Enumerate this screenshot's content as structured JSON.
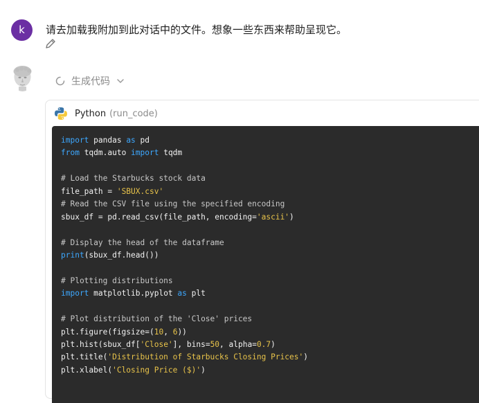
{
  "user": {
    "avatar_letter": "k",
    "avatar_color": "#6b2fa3",
    "message": "请去加载我附加到此对话中的文件。想象一些东西来帮助呈现它。"
  },
  "assistant": {
    "status_label": "生成代码"
  },
  "tool": {
    "language": "Python",
    "function": "(run_code)"
  },
  "code_lines": [
    [
      {
        "t": "import",
        "c": "kw"
      },
      {
        "t": " pandas ",
        "c": "op"
      },
      {
        "t": "as",
        "c": "kw"
      },
      {
        "t": " pd",
        "c": "op"
      }
    ],
    [
      {
        "t": "from",
        "c": "kw"
      },
      {
        "t": " tqdm.auto ",
        "c": "op"
      },
      {
        "t": "import",
        "c": "kw"
      },
      {
        "t": " tqdm",
        "c": "op"
      }
    ],
    [],
    [
      {
        "t": "# Load the Starbucks stock data",
        "c": "cm"
      }
    ],
    [
      {
        "t": "file_path = ",
        "c": "op"
      },
      {
        "t": "'SBUX.csv'",
        "c": "st"
      }
    ],
    [
      {
        "t": "# Read the CSV file using the specified encoding",
        "c": "cm"
      }
    ],
    [
      {
        "t": "sbux_df = pd.read_csv(file_path, encoding=",
        "c": "op"
      },
      {
        "t": "'ascii'",
        "c": "st"
      },
      {
        "t": ")",
        "c": "op"
      }
    ],
    [],
    [
      {
        "t": "# Display the head of the dataframe",
        "c": "cm"
      }
    ],
    [
      {
        "t": "print",
        "c": "kw"
      },
      {
        "t": "(sbux_df.head())",
        "c": "op"
      }
    ],
    [],
    [
      {
        "t": "# Plotting distributions",
        "c": "cm"
      }
    ],
    [
      {
        "t": "import",
        "c": "kw"
      },
      {
        "t": " matplotlib.pyplot ",
        "c": "op"
      },
      {
        "t": "as",
        "c": "kw"
      },
      {
        "t": " plt",
        "c": "op"
      }
    ],
    [],
    [
      {
        "t": "# Plot distribution of the 'Close' prices",
        "c": "cm"
      }
    ],
    [
      {
        "t": "plt.figure(figsize=(",
        "c": "op"
      },
      {
        "t": "10",
        "c": "nm"
      },
      {
        "t": ", ",
        "c": "op"
      },
      {
        "t": "6",
        "c": "nm"
      },
      {
        "t": "))",
        "c": "op"
      }
    ],
    [
      {
        "t": "plt.hist(sbux_df[",
        "c": "op"
      },
      {
        "t": "'Close'",
        "c": "st"
      },
      {
        "t": "], bins=",
        "c": "op"
      },
      {
        "t": "50",
        "c": "nm"
      },
      {
        "t": ", alpha=",
        "c": "op"
      },
      {
        "t": "0.7",
        "c": "nm"
      },
      {
        "t": ")",
        "c": "op"
      }
    ],
    [
      {
        "t": "plt.title(",
        "c": "op"
      },
      {
        "t": "'Distribution of Starbucks Closing Prices'",
        "c": "st"
      },
      {
        "t": ")",
        "c": "op"
      }
    ],
    [
      {
        "t": "plt.xlabel(",
        "c": "op"
      },
      {
        "t": "'Closing Price ($)'",
        "c": "st"
      },
      {
        "t": ")",
        "c": "op"
      }
    ]
  ]
}
